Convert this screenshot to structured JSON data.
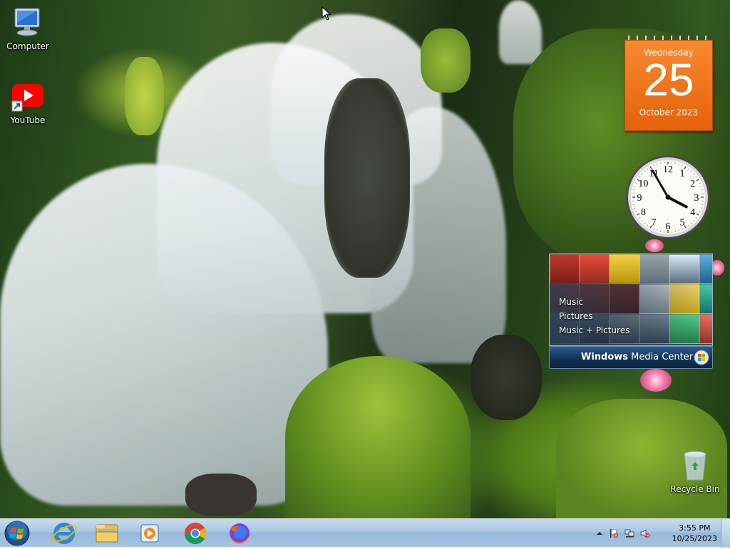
{
  "desktop": {
    "icons": [
      {
        "label": "Computer",
        "icon": "computer-icon"
      },
      {
        "label": "YouTube",
        "icon": "youtube-shortcut-icon"
      },
      {
        "label": "Recycle Bin",
        "icon": "recycle-bin-icon"
      }
    ],
    "wallpaper": "waterfall in mossy forest"
  },
  "gadgets": {
    "calendar": {
      "weekday": "Wednesday",
      "day": "25",
      "month_year": "October 2023",
      "color": "#e86a10"
    },
    "clock": {
      "hour": 3,
      "minute": 55,
      "numerals": [
        "12",
        "1",
        "2",
        "3",
        "4",
        "5",
        "6",
        "7",
        "8",
        "9",
        "10",
        "11"
      ]
    },
    "media_center": {
      "menu": [
        "Music",
        "Pictures",
        "Music + Pictures"
      ],
      "brand_windows": "Windows",
      "brand_rest": " Media Center"
    }
  },
  "taskbar": {
    "pinned": [
      {
        "name": "internet-explorer-icon"
      },
      {
        "name": "file-explorer-icon"
      },
      {
        "name": "media-player-icon"
      },
      {
        "name": "chrome-icon"
      },
      {
        "name": "firefox-icon"
      }
    ],
    "tray": {
      "time": "3:55 PM",
      "date": "10/25/2023",
      "icons": [
        "show-hidden-icons-arrow",
        "action-center-flag-icon",
        "network-icon",
        "volume-muted-icon"
      ]
    }
  },
  "colors": {
    "taskbar": "#a9c6e3",
    "calendar": "#e86a10",
    "youtube": "#ff0000"
  }
}
